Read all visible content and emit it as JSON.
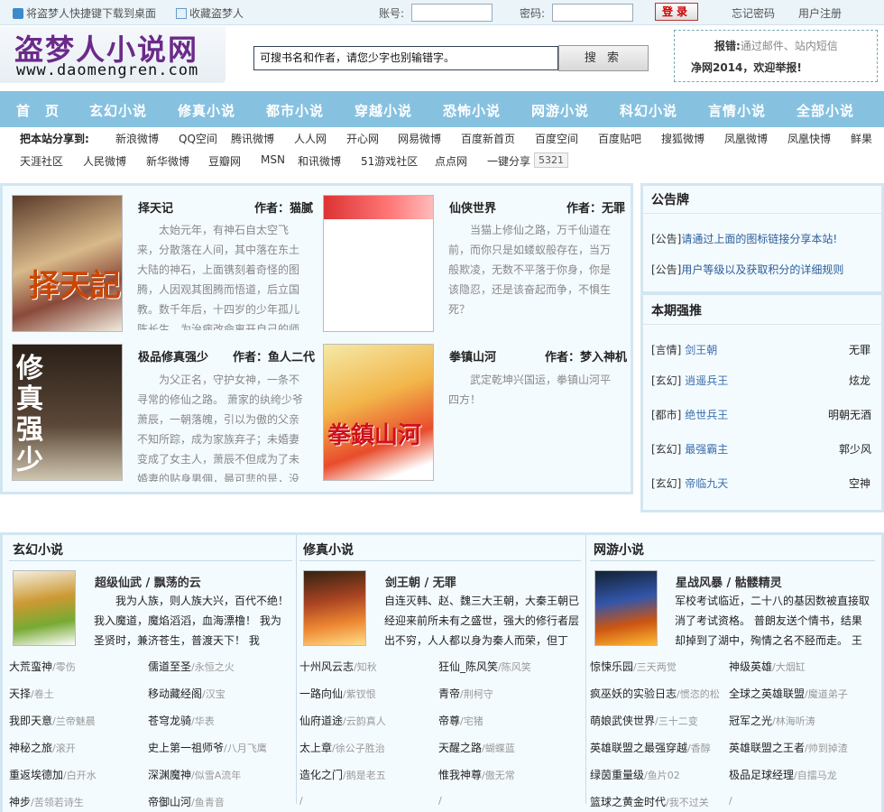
{
  "topbar": {
    "shortcut": "将盗梦人快捷键下载到桌面",
    "favorite": "收藏盗梦人",
    "account_label": "账号:",
    "password_label": "密码:",
    "login": "登录",
    "forgot": "忘记密码",
    "register": "用户注册"
  },
  "header": {
    "logo_text": "盗梦人小说网",
    "logo_url": "www.daomengren.com",
    "search_placeholder": "可搜书名和作者，请您少字也别输错字。",
    "search_button": "搜 索",
    "report_label": "报错:",
    "report_text": "通过邮件、站内短信",
    "report_slogan": "净网2014，欢迎举报!"
  },
  "nav": [
    "首　页",
    "玄幻小说",
    "修真小说",
    "都市小说",
    "穿越小说",
    "恐怖小说",
    "网游小说",
    "科幻小说",
    "言情小说",
    "全部小说"
  ],
  "share": {
    "label": "把本站分享到:",
    "row1": [
      "新浪微博",
      "QQ空间",
      "腾讯微博",
      "人人网",
      "开心网",
      "网易微博",
      "百度新首页",
      "百度空间",
      "百度贴吧",
      "搜狐微博",
      "凤凰微博",
      "凤凰快博",
      "鲜果"
    ],
    "row2": [
      "天涯社区",
      "人民微博",
      "新华微博",
      "豆瓣网",
      "MSN",
      "和讯微博",
      "51游戏社区",
      "点点网",
      "一键分享"
    ],
    "count": "5321"
  },
  "featured": [
    {
      "title": "择天记",
      "author": "作者：猫腻",
      "desc": "太始元年，有神石自太空飞来，分散落在人间，其中落在东土大陆的神石，上面镌刻着奇怪的图腾，人因观其图腾而悟道，后立国教。数千年后，十四岁的少年孤儿陈长生，为治病改命离开自己的师"
    },
    {
      "title": "仙侠世界",
      "author": "作者：无罪",
      "desc": "当猫上修仙之路，万千仙道在前，而你只是如蝼蚁般存在，当万般欺凌，无数不平落于你身，你是该隐忍，还是该奋起而争，不惧生死？"
    },
    {
      "title": "极品修真强少",
      "author": "作者：鱼人二代",
      "desc": "为父正名，守护女神，一条不寻常的修仙之路。 萧家的纨绔少爷萧辰，一朝落魄，引以为傲的父亲不知所踪，成为家族弃子；未婚妻变成了女主人，萧辰不但成为了未婚妻的贴身男佣，最可悲的是，没"
    },
    {
      "title": "拳镇山河",
      "author": "作者：梦入神机",
      "desc": "武定乾坤兴国运，拳镇山河平四方！"
    }
  ],
  "sidebar": {
    "notice_title": "公告牌",
    "notices": [
      {
        "tag": "[公告]",
        "text": "请通过上面的图标链接分享本站!"
      },
      {
        "tag": "[公告]",
        "text": "用户等级以及获取积分的详细规则"
      }
    ],
    "rec_title": "本期强推",
    "recs": [
      {
        "cat": "[言情]",
        "book": "剑王朝",
        "author": "无罪"
      },
      {
        "cat": "[玄幻]",
        "book": "逍遥兵王",
        "author": "炫龙"
      },
      {
        "cat": "[都市]",
        "book": "绝世兵王",
        "author": "明朝无酒"
      },
      {
        "cat": "[玄幻]",
        "book": "最强霸主",
        "author": "郭少风"
      },
      {
        "cat": "[玄幻]",
        "book": "帝临九天",
        "author": "空神"
      }
    ]
  },
  "sections": [
    {
      "title": "玄幻小说",
      "headline": "超级仙武 / 飘荡的云",
      "desc": "我为人族，则人族大兴，百代不绝！我入魔道，魔焰滔滔，血海漂橹！ 我为圣贤时，兼济苍生，普渡天下！ 我",
      "list": [
        [
          "大荒蛮神",
          "/零伤"
        ],
        [
          "儒道至圣",
          "/永恒之火"
        ],
        [
          "天择",
          "/卷土"
        ],
        [
          "移动藏经阁",
          "/汉宝"
        ],
        [
          "我即天意",
          "/兰帝魅晨"
        ],
        [
          "苍穹龙骑",
          "/华表"
        ],
        [
          "神秘之旅",
          "/滚开"
        ],
        [
          "史上第一祖师爷",
          "/八月飞鹰"
        ],
        [
          "重返埃德加",
          "/白开水"
        ],
        [
          "深渊魔神",
          "/似雪A流年"
        ],
        [
          "神步",
          "/苦领若诗生"
        ],
        [
          "帝御山河",
          "/鱼青音"
        ]
      ]
    },
    {
      "title": "修真小说",
      "headline": "剑王朝 / 无罪",
      "desc": "自连灭韩、赵、魏三大王朝，大秦王朝已经迎来前所未有之盛世，强大的修行者层出不穷，人人都以身为秦人而荣，但丁",
      "list": [
        [
          "十州风云志",
          "/知秋"
        ],
        [
          "狂仙_陈风笑",
          "/陈风笑"
        ],
        [
          "一路向仙",
          "/紫钗恨"
        ],
        [
          "青帝",
          "/荆柯守"
        ],
        [
          "仙府道途",
          "/云韵真人"
        ],
        [
          "帝尊",
          "/宅猪"
        ],
        [
          "太上章",
          "/徐公子胜治"
        ],
        [
          "天醒之路",
          "/蝴蝶蓝"
        ],
        [
          "造化之门",
          "/鹅是老五"
        ],
        [
          "惟我神尊",
          "/傲无常"
        ],
        [
          "",
          "/"
        ],
        [
          "",
          "/"
        ]
      ]
    },
    {
      "title": "网游小说",
      "headline": "星战风暴 / 骷髅精灵",
      "desc": "军校考试临近，二十八的基因数被直接取消了考试资格。 普朗友送个情书，结果却掉到了湖中，殉情之名不胫而走。 王",
      "list": [
        [
          "惊悚乐园",
          "/三天两觉"
        ],
        [
          "神级英雄",
          "/大烟缸"
        ],
        [
          "疯巫妖的实验日志",
          "/惯恣的松"
        ],
        [
          "全球之英雄联盟",
          "/魔道弟子"
        ],
        [
          "萌娘武侠世界",
          "/三十二变"
        ],
        [
          "冠军之光",
          "/林海听涛"
        ],
        [
          "英雄联盟之最强穿越",
          "/香醇"
        ],
        [
          "英雄联盟之王者",
          "/帅到掉渣"
        ],
        [
          "绿茵重量级",
          "/鱼片02"
        ],
        [
          "极品足球经理",
          "/自擂马龙"
        ],
        [
          "篮球之黄金时代",
          "/我不过关"
        ],
        [
          "",
          "/"
        ]
      ]
    }
  ]
}
